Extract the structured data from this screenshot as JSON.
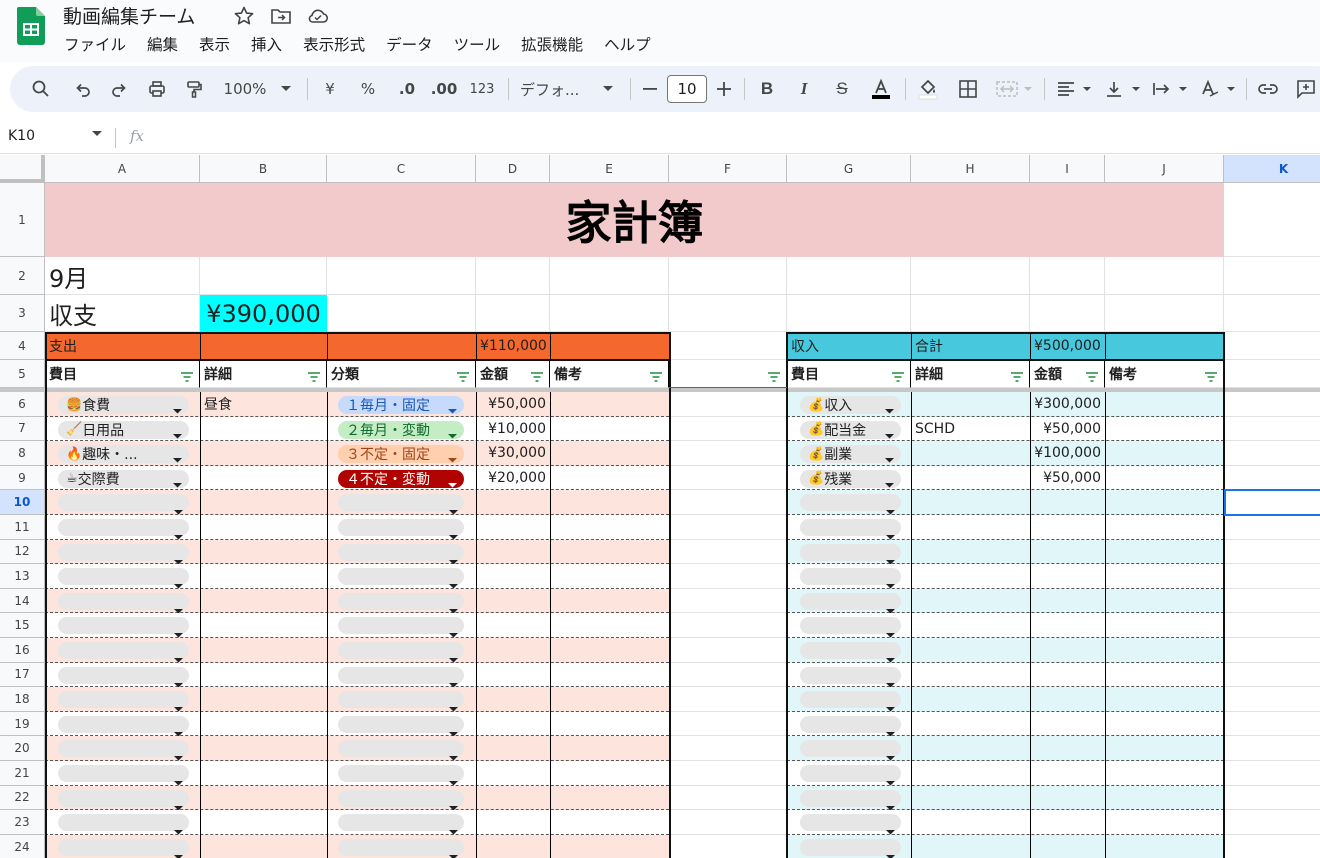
{
  "doc": {
    "title": "動画編集チーム"
  },
  "menu": [
    "ファイル",
    "編集",
    "表示",
    "挿入",
    "表示形式",
    "データ",
    "ツール",
    "拡張機能",
    "ヘルプ"
  ],
  "toolbar": {
    "zoom": "100%",
    "currency": "¥",
    "percent": "%",
    "dec_less": ".0",
    "dec_more": ".00",
    "number_format": "123",
    "font": "デフォ...",
    "font_size": "10"
  },
  "formula_bar": {
    "name_box": "K10",
    "fx_label": "fx",
    "value": ""
  },
  "columns": [
    "A",
    "B",
    "C",
    "D",
    "E",
    "F",
    "G",
    "H",
    "I",
    "J",
    "K"
  ],
  "rows": [
    "1",
    "2",
    "3",
    "4",
    "5",
    "6",
    "7",
    "8",
    "9",
    "10",
    "11",
    "12",
    "13",
    "14",
    "15",
    "16",
    "17",
    "18",
    "19",
    "20",
    "21",
    "22",
    "23",
    "24"
  ],
  "selected_cell": "K10",
  "sheet": {
    "title": "家計簿",
    "month": "9月",
    "balance_label": "収支",
    "balance": "¥390,000",
    "expense": {
      "label": "支出",
      "total": "¥110,000",
      "headers": [
        "費目",
        "詳細",
        "分類",
        "金額",
        "備考"
      ],
      "rows": [
        {
          "icon": "🍔",
          "item": "食費",
          "detail": "昼食",
          "category": "１毎月・固定",
          "amount": "¥50,000"
        },
        {
          "icon": "🧹",
          "item": "日用品",
          "detail": "",
          "category": "２毎月・変動",
          "amount": "¥10,000"
        },
        {
          "icon": "🔥",
          "item": "趣味・...",
          "detail": "",
          "category": "３不定・固定",
          "amount": "¥30,000"
        },
        {
          "icon": "☕",
          "item": "交際費",
          "detail": "",
          "category": "４不定・変動",
          "amount": "¥20,000"
        }
      ]
    },
    "income": {
      "label": "収入",
      "total_label": "合計",
      "total": "¥500,000",
      "headers": [
        "費目",
        "詳細",
        "金額",
        "備考"
      ],
      "rows": [
        {
          "icon": "💰",
          "item": "収入",
          "detail": "",
          "amount": "¥300,000"
        },
        {
          "icon": "💰",
          "item": "配当金",
          "detail": "SCHD",
          "amount": "¥50,000"
        },
        {
          "icon": "💰",
          "item": "副業",
          "detail": "",
          "amount": "¥100,000"
        },
        {
          "icon": "💰",
          "item": "残業",
          "detail": "",
          "amount": "¥50,000"
        }
      ]
    }
  },
  "colors": {
    "title_bg": "#f3cacb",
    "expense_header": "#f4682d",
    "expense_band": "#fde4dc",
    "income_header": "#47c8dc",
    "income_band": "#e0f6f8",
    "balance_bg": "#00ffff",
    "cat1": "#c6dbfc",
    "cat2": "#c5edc5",
    "cat3": "#ffcfae",
    "cat4": "#b10202"
  }
}
